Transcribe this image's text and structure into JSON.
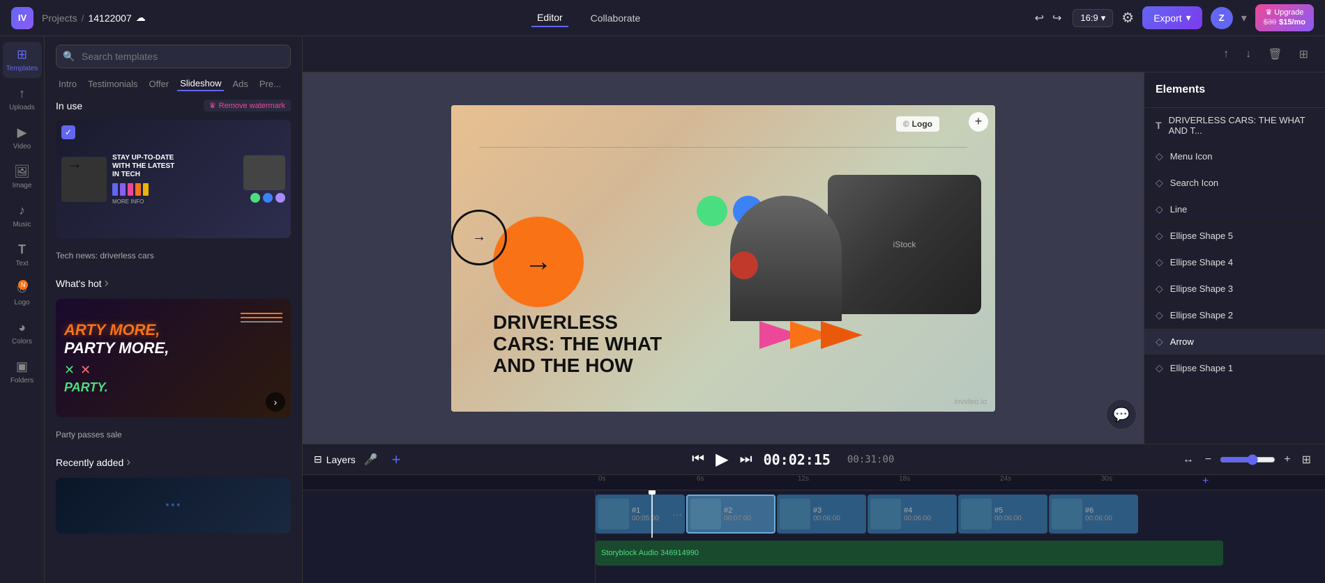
{
  "topbar": {
    "logo_text": "IV",
    "project_label": "Projects",
    "separator": "/",
    "project_id": "14122007",
    "editor_tab": "Editor",
    "collaborate_tab": "Collaborate",
    "ratio": "16:9",
    "export_label": "Export",
    "avatar_letter": "Z",
    "upgrade_label": "Upgrade",
    "price_old": "$30",
    "price_new": "$15/mo"
  },
  "left_sidebar": {
    "items": [
      {
        "id": "templates",
        "icon": "⊞",
        "label": "Templates",
        "active": true
      },
      {
        "id": "uploads",
        "icon": "↑",
        "label": "Uploads"
      },
      {
        "id": "video",
        "icon": "▶",
        "label": "Video"
      },
      {
        "id": "image",
        "icon": "🖼",
        "label": "Image"
      },
      {
        "id": "music",
        "icon": "♪",
        "label": "Music"
      },
      {
        "id": "text",
        "icon": "T",
        "label": "Text"
      },
      {
        "id": "logo",
        "icon": "®",
        "label": "Logo"
      },
      {
        "id": "colors",
        "icon": "◕",
        "label": "Colors"
      },
      {
        "id": "folders",
        "icon": "▣",
        "label": "Folders"
      }
    ]
  },
  "templates_panel": {
    "search_placeholder": "Search templates",
    "filter_tabs": [
      "Intro",
      "Testimonials",
      "Offer",
      "Slideshow",
      "Ads",
      "Pre..."
    ],
    "in_use_label": "In use",
    "remove_watermark": "Remove watermark",
    "template1_label": "Tech news: driverless cars",
    "whats_hot_label": "What's hot",
    "whats_hot_chevron": "›",
    "template2_label": "Party passes sale",
    "recently_added_label": "Recently added",
    "recently_added_chevron": "›"
  },
  "canvas": {
    "logo_text": "Logo",
    "add_icon": "+",
    "main_text_line1": "DRIVERLESS",
    "main_text_line2": "CARS: THE WHAT",
    "main_text_line3": "AND THE HOW",
    "watermark": "invideo.io"
  },
  "elements_panel": {
    "title": "Elements",
    "items": [
      {
        "id": "driverless-text",
        "icon": "T",
        "name": "DRIVERLESS CARS: THE WHAT AND T..."
      },
      {
        "id": "menu-icon",
        "icon": "◇",
        "name": "Menu Icon"
      },
      {
        "id": "search-icon",
        "icon": "◇",
        "name": "Search Icon"
      },
      {
        "id": "line",
        "icon": "◇",
        "name": "Line"
      },
      {
        "id": "ellipse-5",
        "icon": "◇",
        "name": "Ellipse Shape 5"
      },
      {
        "id": "ellipse-4",
        "icon": "◇",
        "name": "Ellipse Shape 4"
      },
      {
        "id": "ellipse-3",
        "icon": "◇",
        "name": "Ellipse Shape 3"
      },
      {
        "id": "ellipse-2",
        "icon": "◇",
        "name": "Ellipse Shape 2"
      },
      {
        "id": "arrow",
        "icon": "◇",
        "name": "Arrow"
      },
      {
        "id": "ellipse-1",
        "icon": "◇",
        "name": "Ellipse Shape 1"
      }
    ]
  },
  "timeline": {
    "layers_label": "Layers",
    "mic_icon": "🎤",
    "add_icon": "+",
    "play_icon": "▶",
    "skip_back_icon": "⏮",
    "skip_fwd_icon": "⏭",
    "current_time": "00:02:15",
    "total_time": "00:31:00",
    "zoom_icon_out": "−",
    "zoom_icon_in": "+",
    "expand_icon": "⊞",
    "ruler_marks": [
      "0s",
      "6s",
      "12s",
      "18s",
      "24s",
      "30s"
    ],
    "clips": [
      {
        "num": "#1",
        "time": "00:05:00",
        "selected": false
      },
      {
        "num": "#2",
        "time": "00:07:00",
        "selected": true
      },
      {
        "num": "#3",
        "time": "00:06:00",
        "selected": false
      },
      {
        "num": "#4",
        "time": "00:06:00",
        "selected": false
      },
      {
        "num": "#5",
        "time": "00:06:00",
        "selected": false
      },
      {
        "num": "#6",
        "time": "00:06:00",
        "selected": false
      }
    ],
    "audio_label": "Storyblock Audio 346914990"
  }
}
